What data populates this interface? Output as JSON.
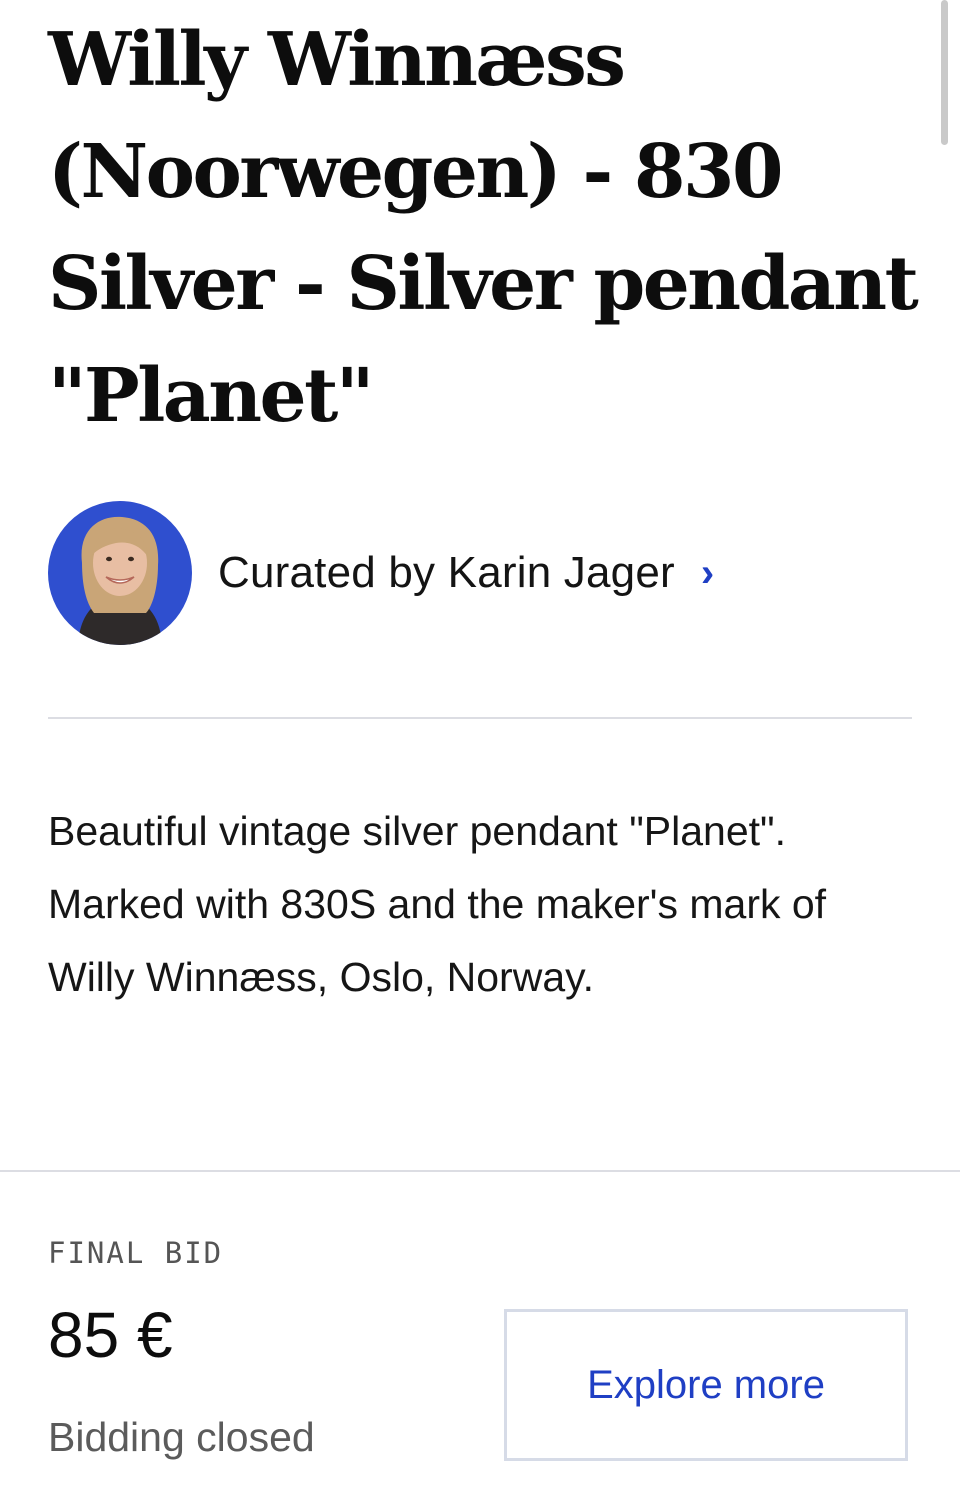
{
  "lot": {
    "title": "Willy Winnæss (Noorwegen) - 830 Silver - Silver pendant \"Planet\""
  },
  "curator": {
    "label": "Curated by Karin Jager",
    "chevron": "›",
    "avatar_icon": "curator-portrait"
  },
  "description": {
    "lines": [
      "Beautiful vintage silver pendant \"Planet\".",
      "Marked with 830S and the maker's mark of Willy Winnæss, Oslo, Norway."
    ]
  },
  "bid": {
    "label": "FINAL BID",
    "value": "85 €",
    "status": "Bidding closed"
  },
  "actions": {
    "explore_label": "Explore more"
  },
  "colors": {
    "accent": "#1f3fc4",
    "divider": "#dcdde3",
    "avatar_background": "#2f4fcf"
  }
}
